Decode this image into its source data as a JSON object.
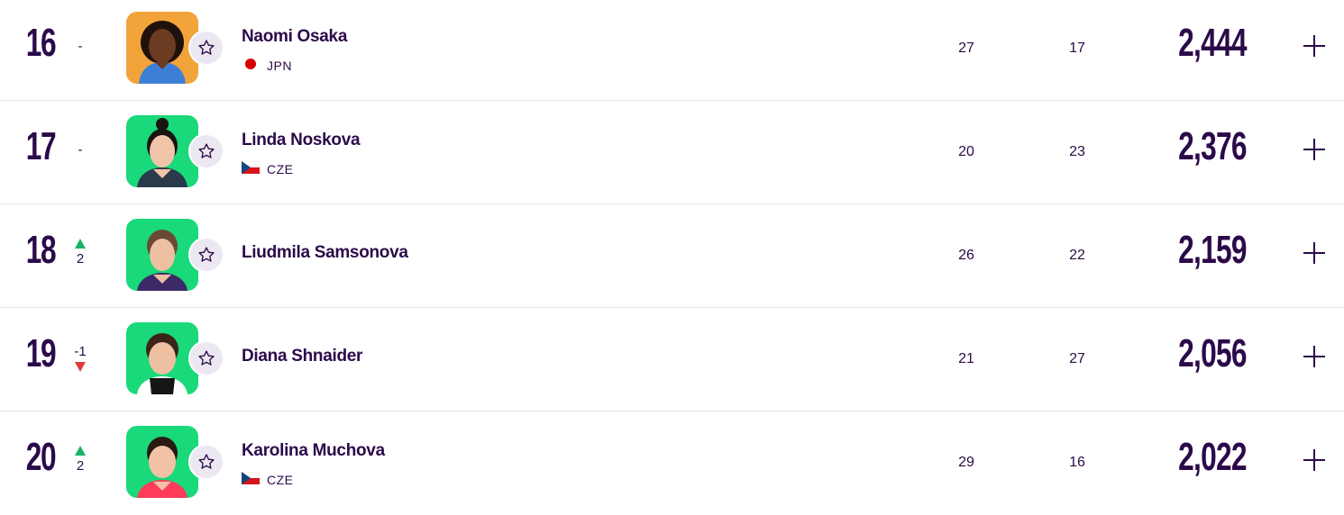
{
  "rankings": [
    {
      "rank": "16",
      "movement": "-",
      "movement_dir": "none",
      "name": "Naomi Osaka",
      "country": "JPN",
      "flag": "japan-flag",
      "stat1": "27",
      "stat2": "17",
      "points": "2,444",
      "photo_bg": "#f2a33a"
    },
    {
      "rank": "17",
      "movement": "-",
      "movement_dir": "none",
      "name": "Linda Noskova",
      "country": "CZE",
      "flag": "czech-flag",
      "stat1": "20",
      "stat2": "23",
      "points": "2,376",
      "photo_bg": "#19d97a"
    },
    {
      "rank": "18",
      "movement": "2",
      "movement_dir": "up",
      "name": "Liudmila Samsonova",
      "country": "",
      "flag": "",
      "stat1": "26",
      "stat2": "22",
      "points": "2,159",
      "photo_bg": "#19d97a"
    },
    {
      "rank": "19",
      "movement": "-1",
      "movement_dir": "down",
      "name": "Diana Shnaider",
      "country": "",
      "flag": "",
      "stat1": "21",
      "stat2": "27",
      "points": "2,056",
      "photo_bg": "#19d97a"
    },
    {
      "rank": "20",
      "movement": "2",
      "movement_dir": "up",
      "name": "Karolina Muchova",
      "country": "CZE",
      "flag": "czech-flag",
      "stat1": "29",
      "stat2": "16",
      "points": "2,022",
      "photo_bg": "#19d97a"
    }
  ],
  "icons": {
    "favorite": "star-outline-icon",
    "expand": "plus-icon"
  },
  "colors": {
    "text": "#2b0a4a",
    "up": "#19b36b",
    "down": "#e03a3a",
    "divider": "#e6e3ea"
  }
}
